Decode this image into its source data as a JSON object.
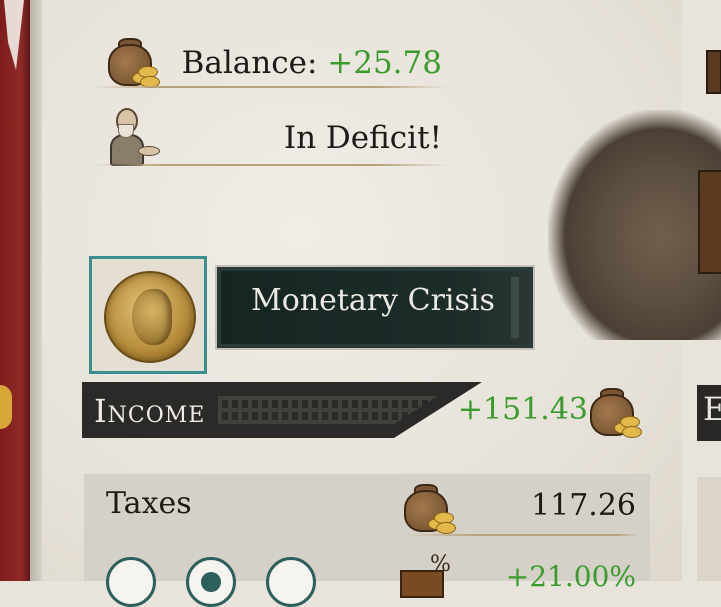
{
  "treasury": {
    "balance_label": "Balance:",
    "balance_value": "+25.78",
    "deficit_text": "In Deficit!"
  },
  "crisis": {
    "name": "Monetary Crisis"
  },
  "income": {
    "label": "Income",
    "value": "+151.43"
  },
  "taxes": {
    "label": "Taxes",
    "value": "117.26",
    "modifier": "+21.00%",
    "rate_options": 3,
    "selected_option_index": 1
  },
  "right_panel": {
    "header_initial": "E"
  },
  "colors": {
    "positive": "#3a9c2d",
    "accent_teal": "#2d5f5c",
    "dark_bar": "#2b2a28"
  },
  "icons": {
    "balance": "coin-bag-icon",
    "advisor": "advisor-icon",
    "income": "coin-bag-icon",
    "taxes": "coin-bag-icon",
    "tax_modifier": "treasure-chest-percent-icon"
  }
}
